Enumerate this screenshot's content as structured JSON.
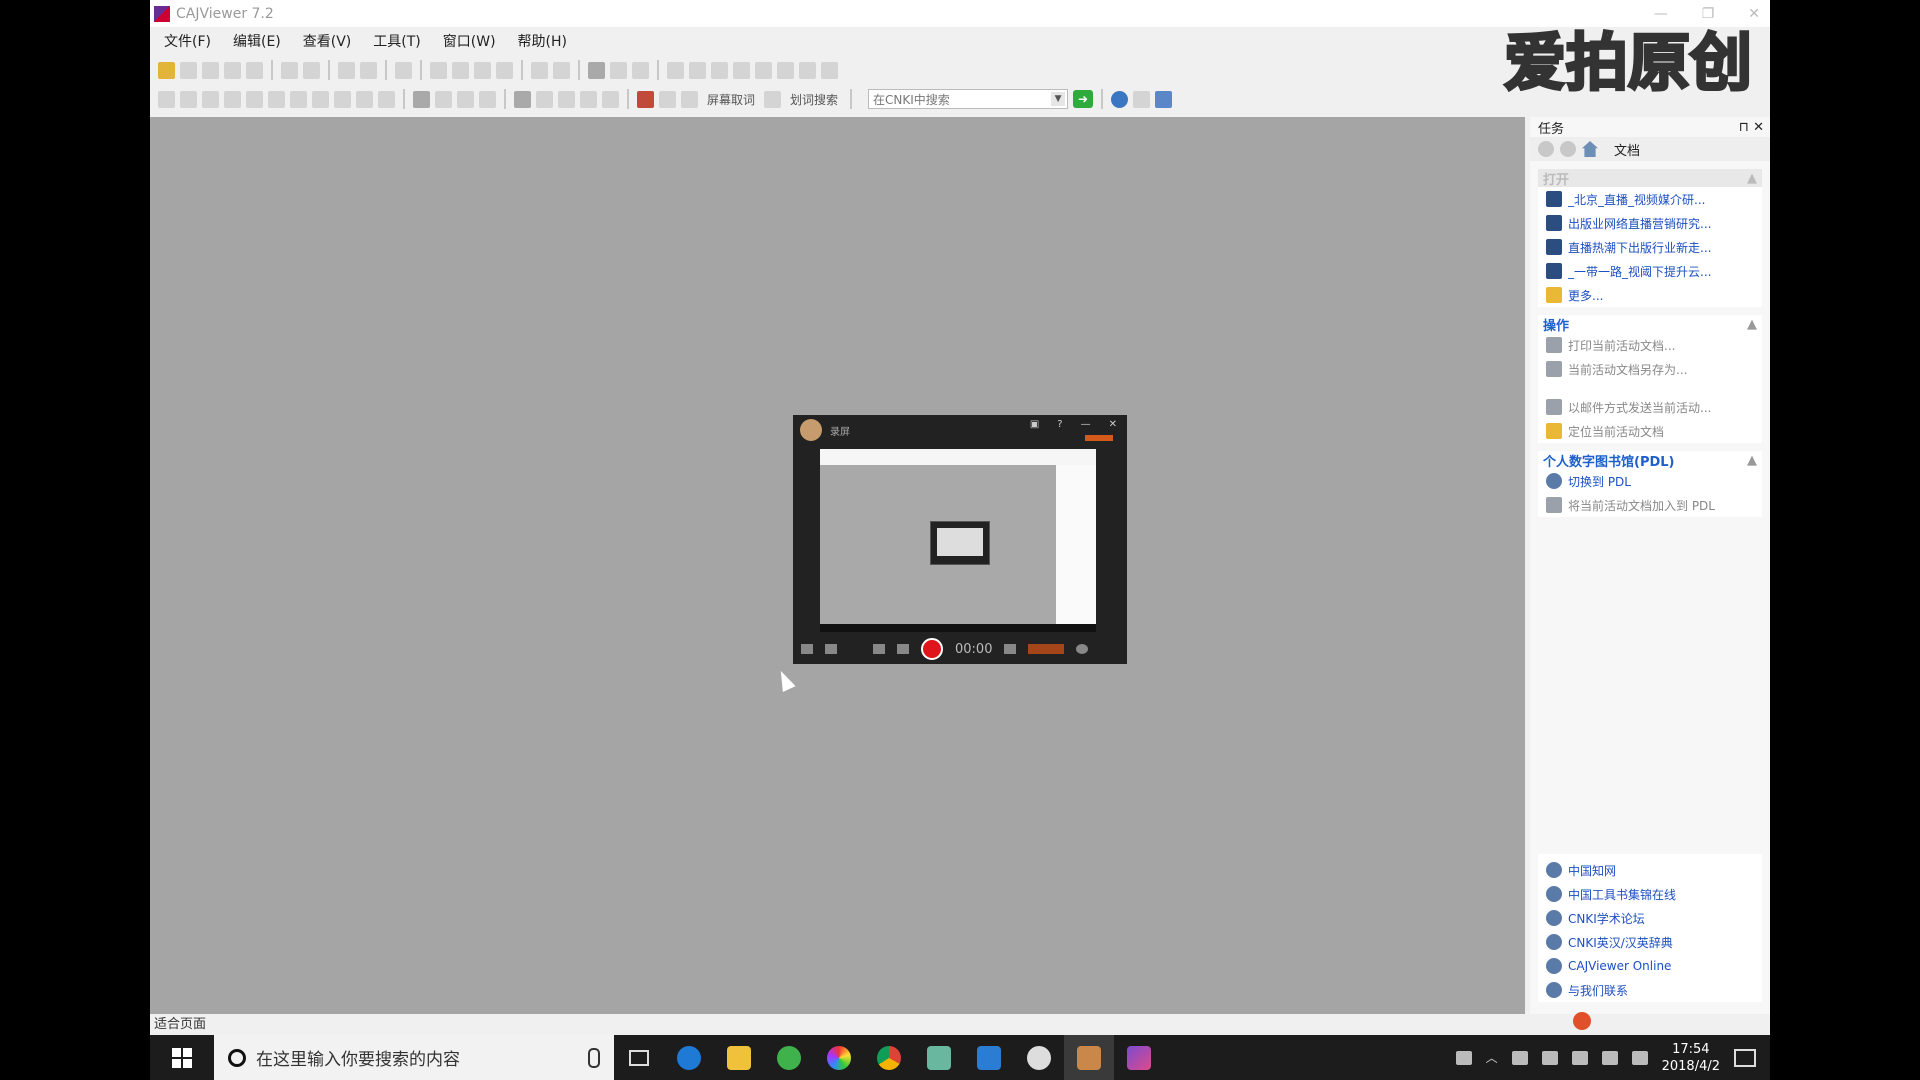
{
  "window": {
    "title": "CAJViewer 7.2"
  },
  "menu": [
    "文件(F)",
    "编辑(E)",
    "查看(V)",
    "工具(T)",
    "窗口(W)",
    "帮助(H)"
  ],
  "toolbar": {
    "find_label": "屏幕取词",
    "search_label": "划词搜索",
    "cnki_search_placeholder": "在CNKI中搜索"
  },
  "task_pane": {
    "title": "任务",
    "dropdown": "文档",
    "open_section": {
      "title": "打开",
      "items": [
        "_北京_直播_视频媒介研...",
        "出版业网络直播营销研究...",
        "直播热潮下出版行业新走...",
        "_一带一路_视阈下提升云...",
        "更多..."
      ]
    },
    "ops_section": {
      "title": "操作",
      "items": [
        "打印当前活动文档...",
        "当前活动文档另存为...",
        "以邮件方式发送当前活动...",
        "定位当前活动文档"
      ]
    },
    "pdl_section": {
      "title": "个人数字图书馆(PDL)",
      "items": [
        "切换到 PDL",
        "将当前活动文档加入到 PDL"
      ]
    },
    "links": [
      "中国知网",
      "中国工具书集锦在线",
      "CNKI学术论坛",
      "CNKI英汉/汉英辞典",
      "CAJViewer Online",
      "与我们联系"
    ]
  },
  "status_bar": {
    "text": "适合页面"
  },
  "recorder": {
    "name": "录屏",
    "timer": "00:00"
  },
  "watermark": {
    "text": "爱拍原创"
  },
  "taskbar": {
    "search_placeholder": "在这里输入你要搜索的内容",
    "time": "17:54",
    "date": "2018/4/2"
  }
}
